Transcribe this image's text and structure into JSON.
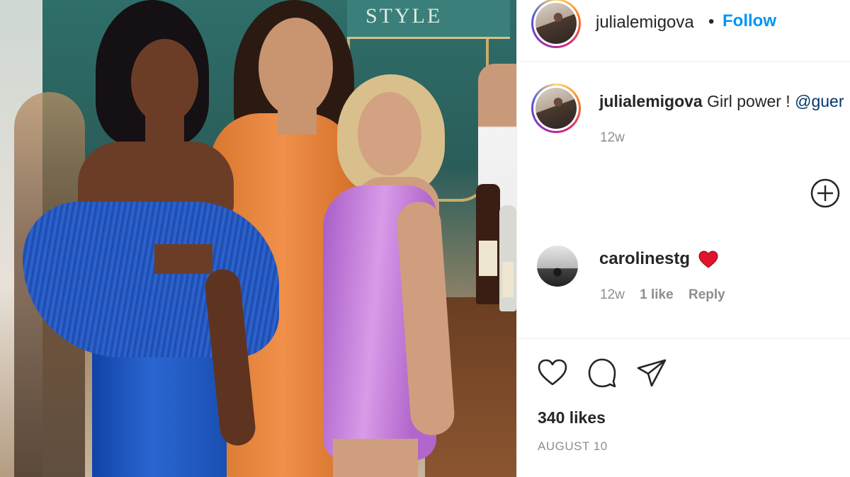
{
  "photo": {
    "background_sign_text": "STYLE",
    "subjects": [
      "woman-in-blue-dress",
      "woman-in-orange-dress",
      "woman-in-lilac-dress"
    ]
  },
  "header": {
    "username": "julialemigova",
    "separator": "•",
    "follow_label": "Follow"
  },
  "caption": {
    "username": "julialemigova",
    "text": "Girl power !",
    "mention": "@guer",
    "time": "12w"
  },
  "comment": {
    "username": "carolinestg",
    "emoji": "heart-emoji",
    "time": "12w",
    "likes": "1 like",
    "reply_label": "Reply"
  },
  "icons": [
    "plus-circle-icon",
    "heart-icon",
    "comment-icon",
    "share-icon"
  ],
  "actions": {
    "likes_text": "340 likes",
    "date_text": "AUGUST 10"
  },
  "colors": {
    "accent_link": "#0095f6",
    "mention": "#00376b",
    "muted": "#8e8e8e",
    "text": "#262626",
    "heart_emoji": "#e0152b"
  }
}
